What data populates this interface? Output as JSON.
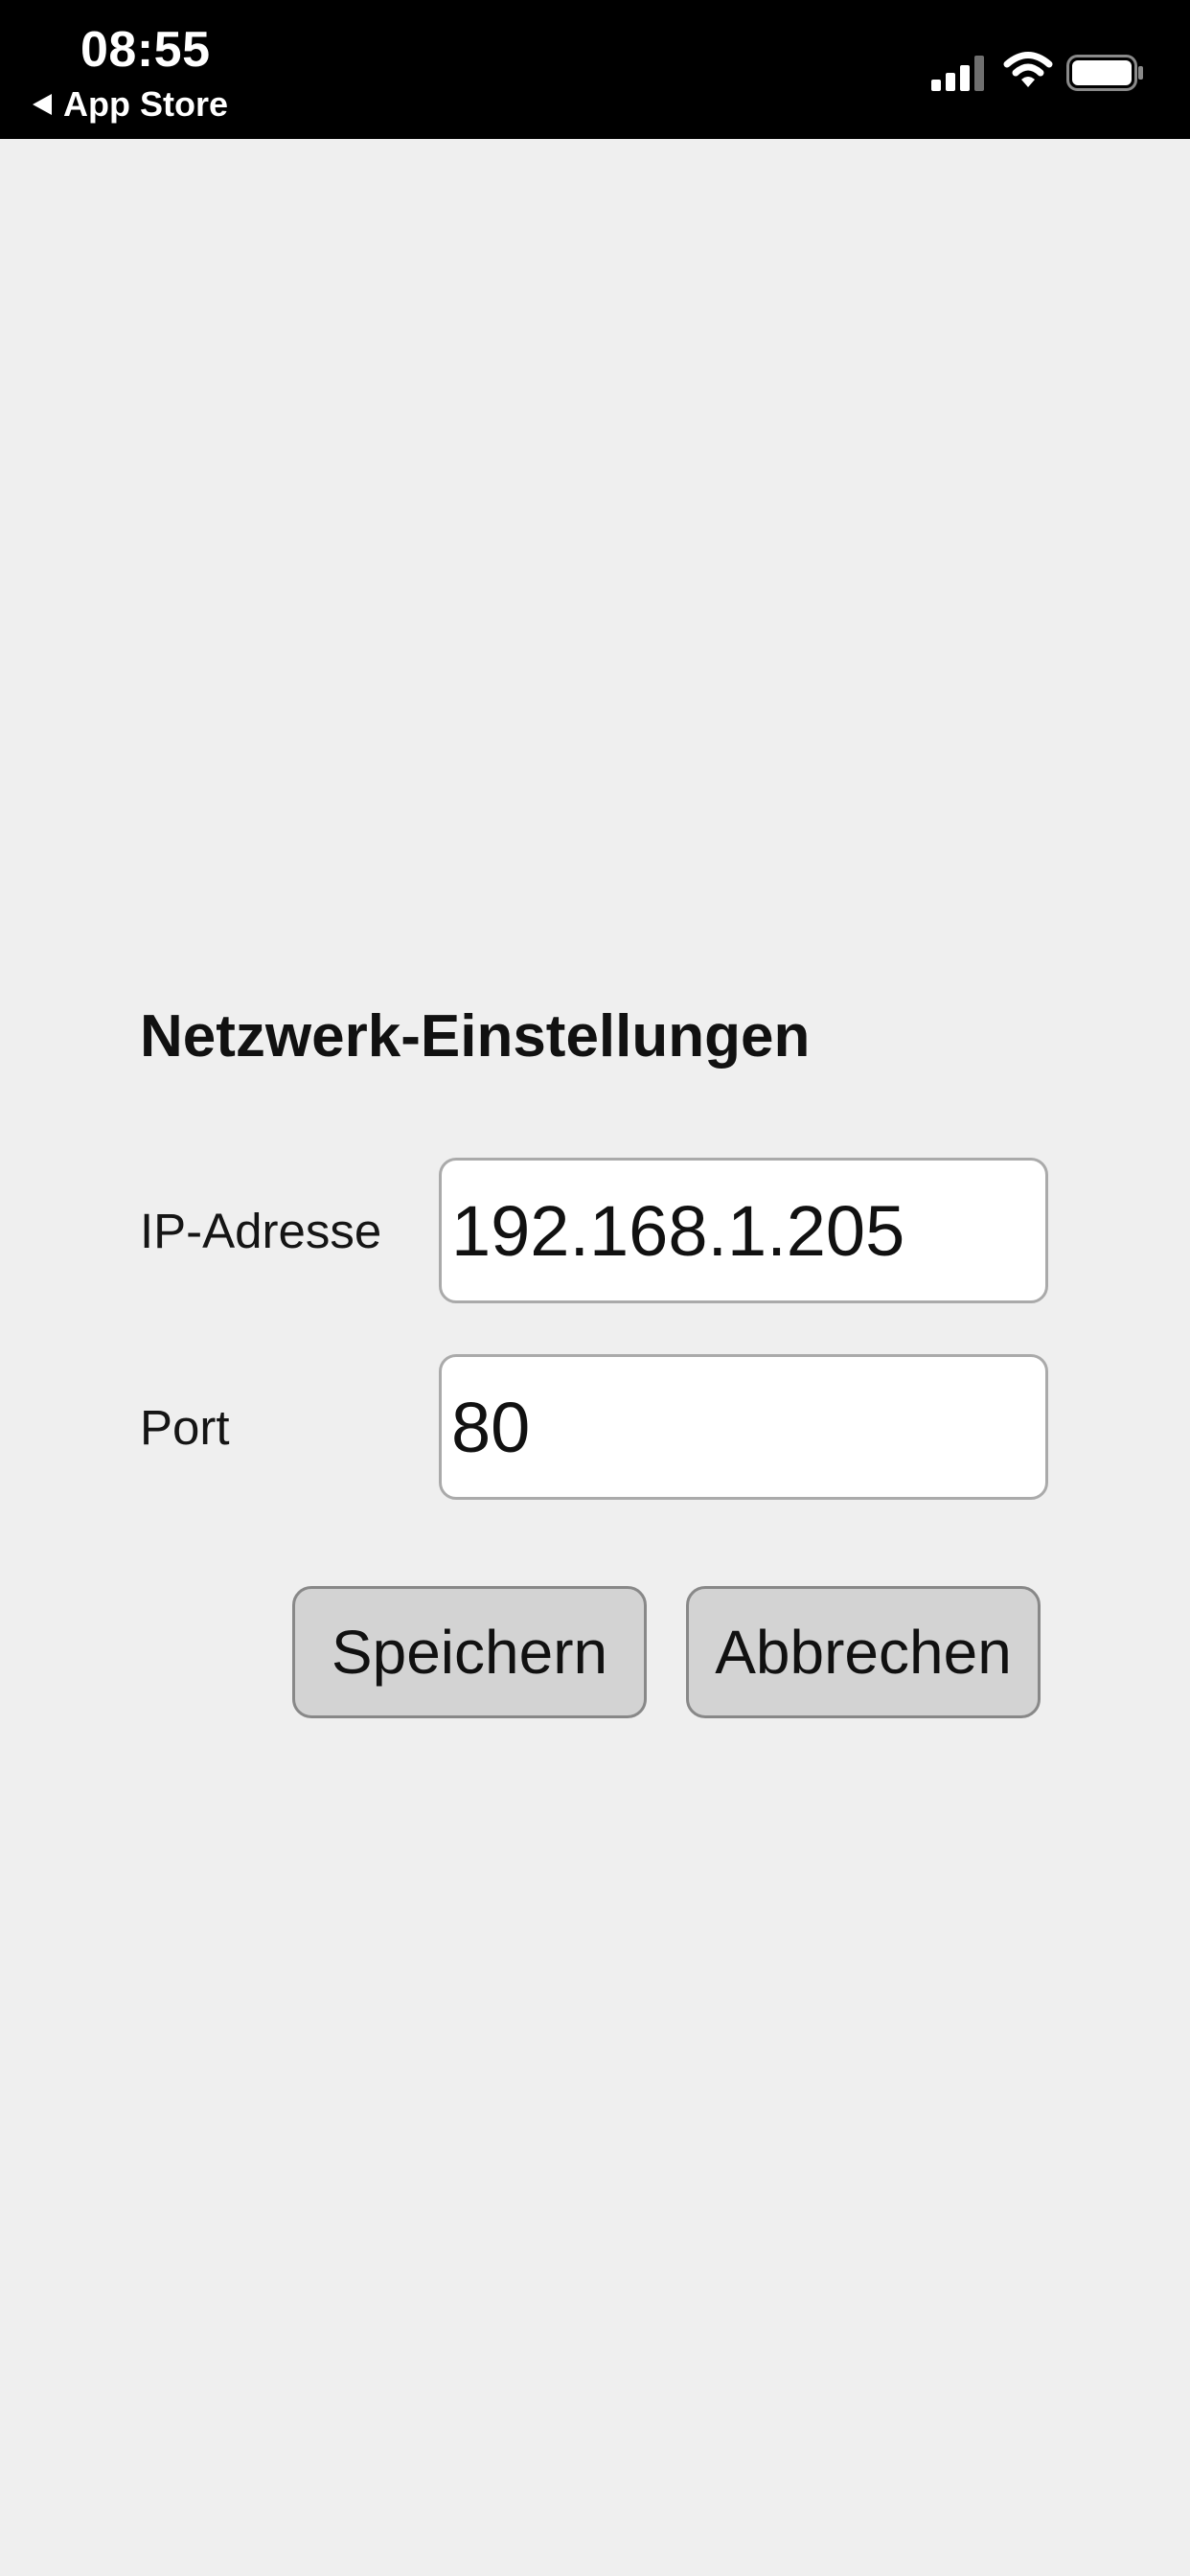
{
  "status_bar": {
    "time": "08:55",
    "back_app": "App Store",
    "icons": [
      "cellular-signal-icon",
      "wifi-icon",
      "battery-icon"
    ]
  },
  "form": {
    "title": "Netzwerk-Einstellungen",
    "ip_label": "IP-Adresse",
    "ip_value": "192.168.1.205",
    "port_label": "Port",
    "port_value": "80"
  },
  "buttons": {
    "save_label": "Speichern",
    "cancel_label": "Abbrechen"
  },
  "colors": {
    "background": "#efefef",
    "status_bar": "#000000",
    "button_fill": "#d3d3d3",
    "field_border": "#aaaaaa"
  }
}
